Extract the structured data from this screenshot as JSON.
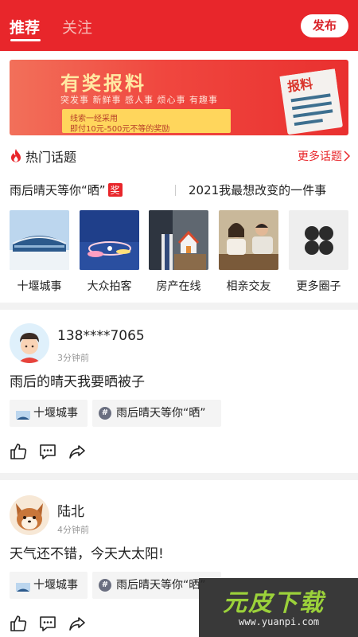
{
  "header": {
    "tabs": [
      {
        "label": "推荐",
        "active": true
      },
      {
        "label": "关注",
        "active": false
      }
    ],
    "publish_label": "发布"
  },
  "banner": {
    "title": "有奖报料",
    "tags": "突发事  新鲜事  感人事  烦心事  有趣事",
    "line1": "线索一经采用",
    "line2": "即付10元-500元不等的奖励",
    "doc_label": "报料"
  },
  "hot_topics": {
    "title": "热门话题",
    "more_label": "更多话题",
    "topics": [
      {
        "label": "雨后晴天等你“晒”",
        "badge": "奖"
      },
      {
        "label": "2021我最想改变的一件事"
      }
    ]
  },
  "circles": [
    {
      "label": "十堰城事"
    },
    {
      "label": "大众拍客"
    },
    {
      "label": "房产在线"
    },
    {
      "label": "相亲交友"
    },
    {
      "label": "更多圈子"
    }
  ],
  "posts": [
    {
      "username": "138****7065",
      "time": "3分钟前",
      "text": "雨后的晴天我要晒被子",
      "tags": [
        "十堰城事",
        "雨后晴天等你“晒”"
      ]
    },
    {
      "username": "陆北",
      "time": "4分钟前",
      "text": "天气还不错，今天大太阳!",
      "tags": [
        "十堰城事",
        "雨后晴天等你“晒”"
      ]
    }
  ],
  "watermark": {
    "logo": "元皮下载",
    "url": "www.yuanpi.com"
  },
  "colors": {
    "brand_red": "#e8262b",
    "banner_yellow": "#ffd65c"
  }
}
